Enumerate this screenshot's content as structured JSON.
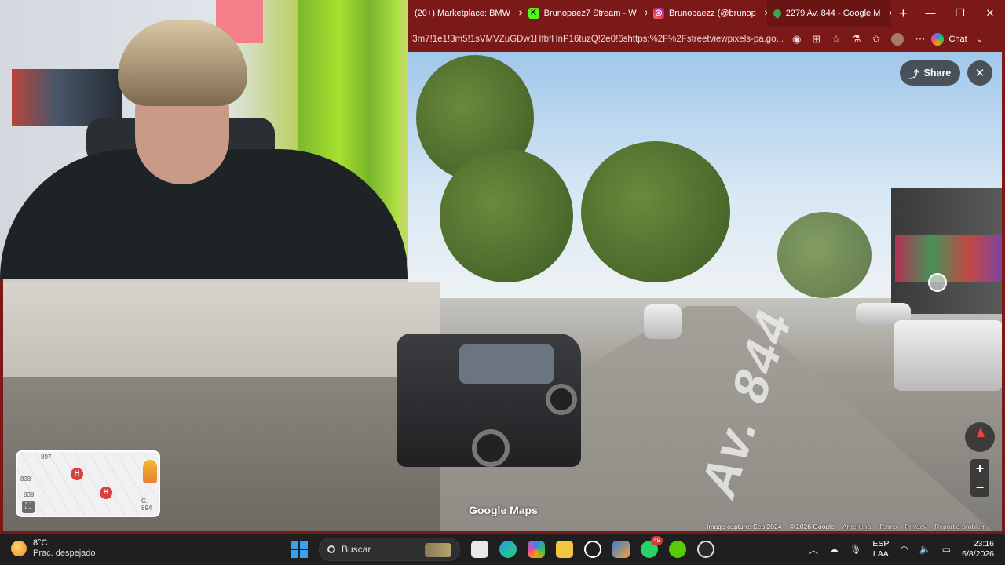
{
  "browser": {
    "tabs": [
      {
        "label": "(20+) Marketplace: BMW",
        "icon": "facebook-icon",
        "color": "#7b1818",
        "active": false
      },
      {
        "label": "Brunopaez7 Stream - W",
        "icon": "kick-icon",
        "color": "#53fc18",
        "active": false
      },
      {
        "label": "Brunopaezz (@brunop",
        "icon": "instagram-icon",
        "color": "#e1306c",
        "active": false
      },
      {
        "label": "2279 Av. 844 - Google M",
        "icon": "google-maps-icon",
        "color": "#34a853",
        "active": true
      }
    ],
    "url": "!3m7!1e1!3m5!1sVMVZuGDw1HfbfHnP16tuzQ!2e0!6shttps:%2F%2Fstreetviewpixels-pa.go...",
    "chat_label": "Chat",
    "theme_color": "#7b1818"
  },
  "maps": {
    "share_label": "Share",
    "close_symbol": "✕",
    "road_marking": "Av. 844",
    "logo_text": "Google Maps",
    "attribution": {
      "capture": "Image capture: Sep 2024",
      "copyright": "© 2026 Google",
      "country": "Argentina",
      "terms": "Terms",
      "privacy": "Privacy",
      "report": "Report a problem"
    },
    "zoom_in": "+",
    "zoom_out": "−",
    "minimap": {
      "labels": [
        "897",
        "838",
        "839",
        "C. 894"
      ],
      "hospital_marker": "H"
    }
  },
  "taskbar": {
    "weather_temp": "8°C",
    "weather_desc": "Prac. despejado",
    "search_placeholder": "Buscar",
    "whatsapp_badge": "49",
    "language": "ESP",
    "keyboard": "LAA",
    "time": "23:16",
    "date": "6/8/2026"
  }
}
